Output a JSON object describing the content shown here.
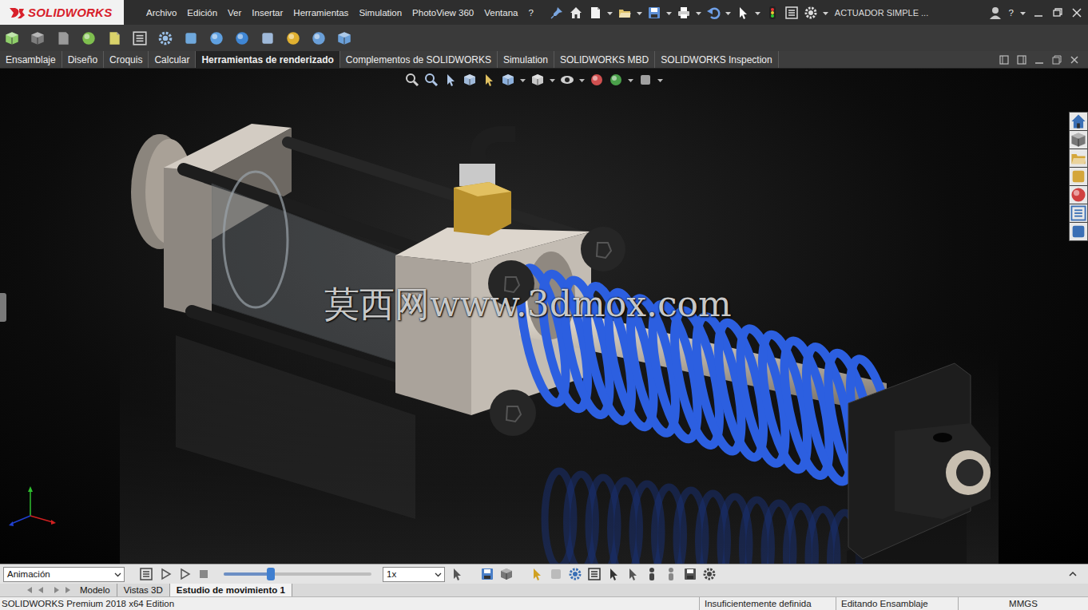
{
  "app": {
    "logo": "SOLIDWORKS",
    "document_title": "ACTUADOR SIMPLE ...",
    "help_glyph": "?"
  },
  "menu": [
    "Archivo",
    "Edición",
    "Ver",
    "Insertar",
    "Herramientas",
    "Simulation",
    "PhotoView 360",
    "Ventana",
    "?"
  ],
  "command_tabs": [
    {
      "label": "Ensamblaje",
      "selected": false
    },
    {
      "label": "Diseño",
      "selected": false
    },
    {
      "label": "Croquis",
      "selected": false
    },
    {
      "label": "Calcular",
      "selected": false
    },
    {
      "label": "Herramientas de renderizado",
      "selected": true
    },
    {
      "label": "Complementos de SOLIDWORKS",
      "selected": false
    },
    {
      "label": "Simulation",
      "selected": false
    },
    {
      "label": "SOLIDWORKS MBD",
      "selected": false
    },
    {
      "label": "SOLIDWORKS Inspection",
      "selected": false
    }
  ],
  "viewport": {
    "watermark": "莫西网www.3dmox.com"
  },
  "motion_toolbar": {
    "study_type": "Animación",
    "time_level": 0.32,
    "speed": "1x"
  },
  "bottom_tabs": [
    {
      "label": "Modelo",
      "selected": false
    },
    {
      "label": "Vistas 3D",
      "selected": false
    },
    {
      "label": "Estudio de movimiento 1",
      "selected": true
    }
  ],
  "status_bar": {
    "product": "SOLIDWORKS Premium 2018 x64 Edition",
    "items": [
      "Insuficientemente definida",
      "Editando Ensamblaje",
      "MMGS"
    ]
  }
}
